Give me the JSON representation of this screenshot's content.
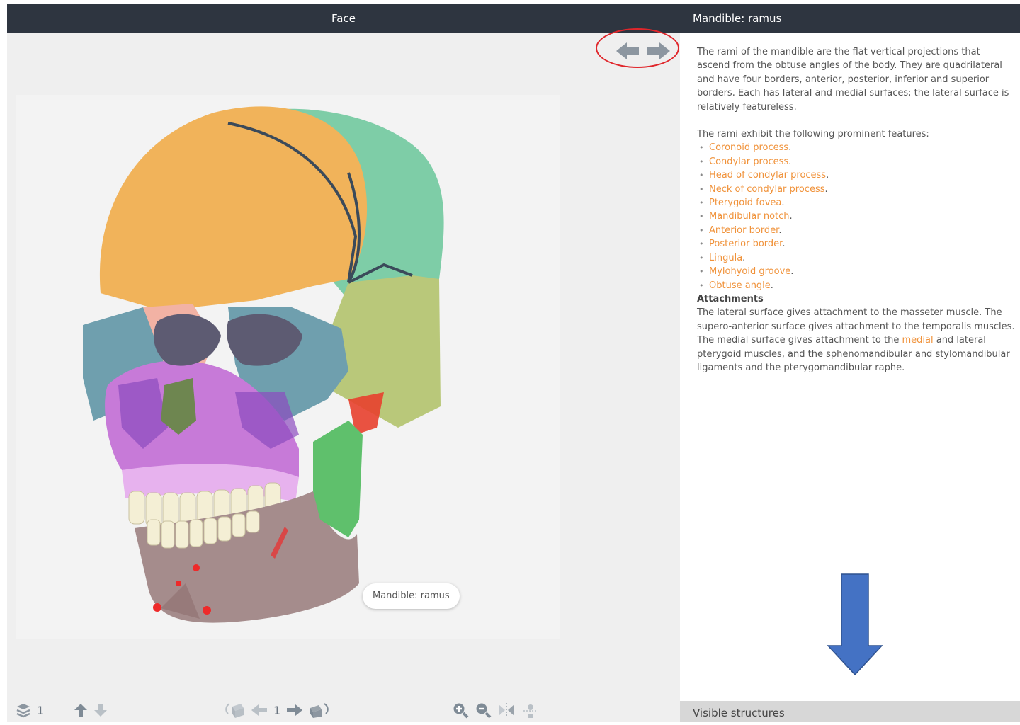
{
  "left_header": {
    "title": "Face"
  },
  "right_header": {
    "title": "Mandible: ramus"
  },
  "model_tooltip": {
    "label": "Mandible: ramus"
  },
  "description": {
    "paragraph1": "The rami of the mandible are the flat vertical projections that ascend from the obtuse angles of the body. They are quadrilateral and have four borders, anterior, posterior, inferior and superior borders. Each has lateral and medial surfaces; the lateral surface is relatively featureless.",
    "paragraph2": "The rami exhibit the following prominent features:",
    "features": [
      "Coronoid process",
      "Condylar process",
      "Head of condylar process",
      "Neck of condylar process",
      "Pterygoid fovea",
      "Mandibular notch",
      "Anterior border",
      "Posterior border",
      "Lingula",
      "Mylohyoid groove",
      "Obtuse angle"
    ],
    "attachments_title": "Attachments",
    "attachments_text_before": "The lateral surface gives attachment to the masseter muscle. The supero-anterior surface gives attachment to the temporalis muscles. The medial surface gives attachment to the ",
    "attachments_link": "medial",
    "attachments_text_after": " and lateral pterygoid muscles, and the sphenomandibular and stylomandibular ligaments and the pterygomandibular raphe."
  },
  "toolbar": {
    "layers_count": "1",
    "step_number": "1",
    "icons": [
      "layers-icon",
      "arrow-up-icon",
      "arrow-down-icon",
      "rotate-left-icon",
      "arrow-left-icon",
      "arrow-right-icon",
      "rotate-right-icon",
      "zoom-in-icon",
      "zoom-out-icon",
      "mirror-icon",
      "light-icon"
    ]
  },
  "visible_structures": {
    "label": "Visible structures"
  },
  "colors": {
    "header_bg": "#2e3540",
    "link": "#f0923a",
    "annotation_red": "#e0262b",
    "annotation_blue": "#4472c4"
  }
}
